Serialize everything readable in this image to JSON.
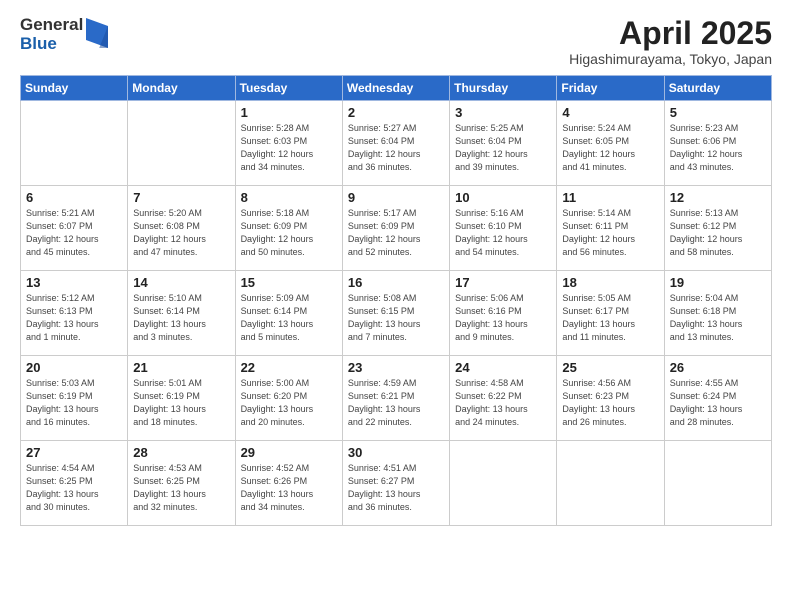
{
  "header": {
    "logo": {
      "general": "General",
      "blue": "Blue"
    },
    "title": "April 2025",
    "location": "Higashimurayama, Tokyo, Japan"
  },
  "weekdays": [
    "Sunday",
    "Monday",
    "Tuesday",
    "Wednesday",
    "Thursday",
    "Friday",
    "Saturday"
  ],
  "weeks": [
    [
      {
        "day": "",
        "info": ""
      },
      {
        "day": "",
        "info": ""
      },
      {
        "day": "1",
        "info": "Sunrise: 5:28 AM\nSunset: 6:03 PM\nDaylight: 12 hours\nand 34 minutes."
      },
      {
        "day": "2",
        "info": "Sunrise: 5:27 AM\nSunset: 6:04 PM\nDaylight: 12 hours\nand 36 minutes."
      },
      {
        "day": "3",
        "info": "Sunrise: 5:25 AM\nSunset: 6:04 PM\nDaylight: 12 hours\nand 39 minutes."
      },
      {
        "day": "4",
        "info": "Sunrise: 5:24 AM\nSunset: 6:05 PM\nDaylight: 12 hours\nand 41 minutes."
      },
      {
        "day": "5",
        "info": "Sunrise: 5:23 AM\nSunset: 6:06 PM\nDaylight: 12 hours\nand 43 minutes."
      }
    ],
    [
      {
        "day": "6",
        "info": "Sunrise: 5:21 AM\nSunset: 6:07 PM\nDaylight: 12 hours\nand 45 minutes."
      },
      {
        "day": "7",
        "info": "Sunrise: 5:20 AM\nSunset: 6:08 PM\nDaylight: 12 hours\nand 47 minutes."
      },
      {
        "day": "8",
        "info": "Sunrise: 5:18 AM\nSunset: 6:09 PM\nDaylight: 12 hours\nand 50 minutes."
      },
      {
        "day": "9",
        "info": "Sunrise: 5:17 AM\nSunset: 6:09 PM\nDaylight: 12 hours\nand 52 minutes."
      },
      {
        "day": "10",
        "info": "Sunrise: 5:16 AM\nSunset: 6:10 PM\nDaylight: 12 hours\nand 54 minutes."
      },
      {
        "day": "11",
        "info": "Sunrise: 5:14 AM\nSunset: 6:11 PM\nDaylight: 12 hours\nand 56 minutes."
      },
      {
        "day": "12",
        "info": "Sunrise: 5:13 AM\nSunset: 6:12 PM\nDaylight: 12 hours\nand 58 minutes."
      }
    ],
    [
      {
        "day": "13",
        "info": "Sunrise: 5:12 AM\nSunset: 6:13 PM\nDaylight: 13 hours\nand 1 minute."
      },
      {
        "day": "14",
        "info": "Sunrise: 5:10 AM\nSunset: 6:14 PM\nDaylight: 13 hours\nand 3 minutes."
      },
      {
        "day": "15",
        "info": "Sunrise: 5:09 AM\nSunset: 6:14 PM\nDaylight: 13 hours\nand 5 minutes."
      },
      {
        "day": "16",
        "info": "Sunrise: 5:08 AM\nSunset: 6:15 PM\nDaylight: 13 hours\nand 7 minutes."
      },
      {
        "day": "17",
        "info": "Sunrise: 5:06 AM\nSunset: 6:16 PM\nDaylight: 13 hours\nand 9 minutes."
      },
      {
        "day": "18",
        "info": "Sunrise: 5:05 AM\nSunset: 6:17 PM\nDaylight: 13 hours\nand 11 minutes."
      },
      {
        "day": "19",
        "info": "Sunrise: 5:04 AM\nSunset: 6:18 PM\nDaylight: 13 hours\nand 13 minutes."
      }
    ],
    [
      {
        "day": "20",
        "info": "Sunrise: 5:03 AM\nSunset: 6:19 PM\nDaylight: 13 hours\nand 16 minutes."
      },
      {
        "day": "21",
        "info": "Sunrise: 5:01 AM\nSunset: 6:19 PM\nDaylight: 13 hours\nand 18 minutes."
      },
      {
        "day": "22",
        "info": "Sunrise: 5:00 AM\nSunset: 6:20 PM\nDaylight: 13 hours\nand 20 minutes."
      },
      {
        "day": "23",
        "info": "Sunrise: 4:59 AM\nSunset: 6:21 PM\nDaylight: 13 hours\nand 22 minutes."
      },
      {
        "day": "24",
        "info": "Sunrise: 4:58 AM\nSunset: 6:22 PM\nDaylight: 13 hours\nand 24 minutes."
      },
      {
        "day": "25",
        "info": "Sunrise: 4:56 AM\nSunset: 6:23 PM\nDaylight: 13 hours\nand 26 minutes."
      },
      {
        "day": "26",
        "info": "Sunrise: 4:55 AM\nSunset: 6:24 PM\nDaylight: 13 hours\nand 28 minutes."
      }
    ],
    [
      {
        "day": "27",
        "info": "Sunrise: 4:54 AM\nSunset: 6:25 PM\nDaylight: 13 hours\nand 30 minutes."
      },
      {
        "day": "28",
        "info": "Sunrise: 4:53 AM\nSunset: 6:25 PM\nDaylight: 13 hours\nand 32 minutes."
      },
      {
        "day": "29",
        "info": "Sunrise: 4:52 AM\nSunset: 6:26 PM\nDaylight: 13 hours\nand 34 minutes."
      },
      {
        "day": "30",
        "info": "Sunrise: 4:51 AM\nSunset: 6:27 PM\nDaylight: 13 hours\nand 36 minutes."
      },
      {
        "day": "",
        "info": ""
      },
      {
        "day": "",
        "info": ""
      },
      {
        "day": "",
        "info": ""
      }
    ]
  ]
}
